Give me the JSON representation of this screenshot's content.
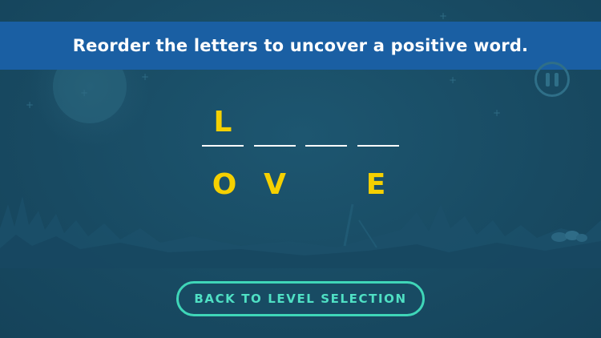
{
  "instruction": {
    "text": "Reorder the letters to uncover a positive word."
  },
  "pause": {
    "icon": "pause-icon"
  },
  "answer": {
    "slots": [
      "L",
      "",
      "",
      ""
    ]
  },
  "tiles": [
    "O",
    "V",
    "",
    "E"
  ],
  "back_button": {
    "label": "BACK TO LEVEL SELECTION"
  },
  "colors": {
    "background": "#1a4d66",
    "banner": "#1a5fa3",
    "letter": "#f5d000",
    "button_border": "#3fd6b8",
    "button_text": "#4fe0c4"
  }
}
